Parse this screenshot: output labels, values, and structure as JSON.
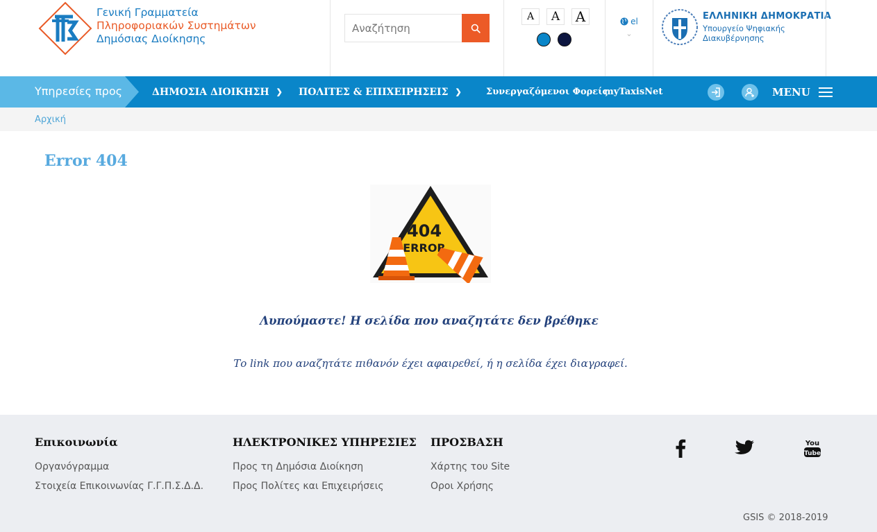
{
  "header": {
    "logo": {
      "line1": "Γενική Γραμματεία",
      "line2": "Πληροφοριακών Συστημάτων",
      "line3": "Δημόσιας Διοίκησης"
    },
    "search": {
      "placeholder": "Αναζήτηση",
      "icon": "search-icon"
    },
    "font_sizes": [
      "A",
      "A",
      "A"
    ],
    "themes": {
      "light": "#0a86c9",
      "dark": "#0d1640"
    },
    "language": {
      "label": "el",
      "icon": "globe-icon"
    },
    "government": {
      "title": "ΕΛΛΗΝΙΚΗ ΔΗΜΟΚΡΑΤΙΑ",
      "ministry_line1": "Υπουργείο Ψηφιακής",
      "ministry_line2": "Διακυβέρνησης"
    }
  },
  "nav": {
    "lead": "Υπηρεσίες προς",
    "items": [
      {
        "label": "ΔΗΜΟΣΙΑ ΔΙΟΙΚΗΣΗ",
        "has_dropdown": true
      },
      {
        "label": "ΠΟΛΙΤΕΣ & ΕΠΙΧΕΙΡΗΣΕΙΣ",
        "has_dropdown": true
      },
      {
        "label": "Συνεργαζόμενοι Φορείς"
      },
      {
        "label": "myTaxisNet"
      }
    ],
    "menu_label": "MENU"
  },
  "breadcrumb": {
    "home": "Αρχική"
  },
  "main": {
    "title": "Error 404",
    "image": {
      "line1": "404",
      "line2": "ERROR"
    },
    "sorry": "Λυπούμαστε!  Η σελίδα που αναζητάτε δεν βρέθηκε",
    "detail": "Το link  που αναζητάτε πιθανόν έχει αφαιρεθεί, ή η σελίδα έχει διαγραφεί."
  },
  "footer": {
    "contact": {
      "title": "Επικοινωνία",
      "links": [
        "Οργανόγραμμα",
        "Στοιχεία Επικοινωνίας Γ.Γ.Π.Σ.Δ.Δ."
      ]
    },
    "eservices": {
      "title": "ΗΛΕΚΤΡΟΝΙΚΕΣ ΥΠΗΡΕΣΙΕΣ",
      "links": [
        "Προς τη Δημόσια Διοίκηση",
        "Προς Πολίτες και Επιχειρήσεις"
      ]
    },
    "access": {
      "title": "ΠΡΟΣΒΑΣΗ",
      "links": [
        "Χάρτης του Site",
        "Οροι Χρήσης"
      ]
    },
    "social": [
      "facebook-icon",
      "twitter-icon",
      "youtube-icon"
    ],
    "youtube_text": {
      "line1": "You",
      "line2": "Tube"
    },
    "copyright": "GSIS © 2018-2019"
  },
  "colors": {
    "brand_blue": "#0a86c9",
    "accent_orange": "#ec5a27",
    "title_blue": "#58aadf",
    "text_navy": "#24427c"
  }
}
